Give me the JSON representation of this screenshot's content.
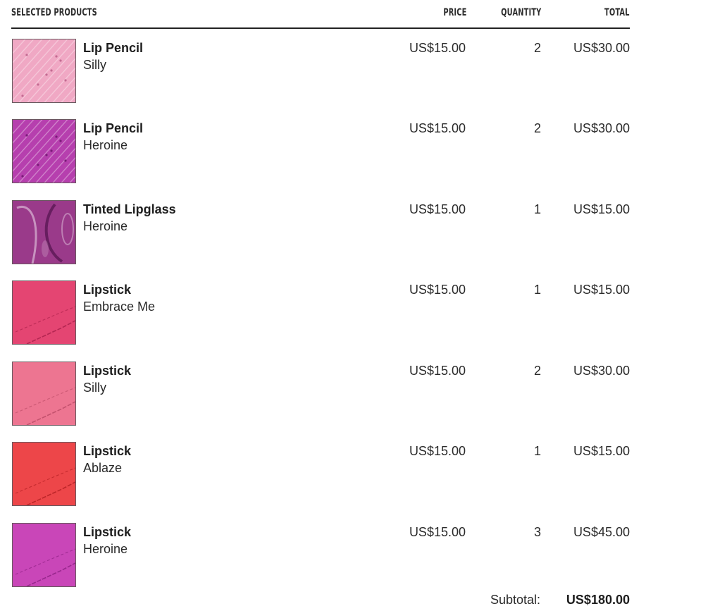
{
  "header": {
    "products": "SELECTED PRODUCTS",
    "price": "PRICE",
    "quantity": "QUANTITY",
    "total": "TOTAL"
  },
  "items": [
    {
      "name": "Lip Pencil",
      "shade": "Silly",
      "price": "US$15.00",
      "quantity": "2",
      "total": "US$30.00",
      "swatch_type": "pencil",
      "swatch_color": "#f0a8c4",
      "swatch_dark": "#c46b92"
    },
    {
      "name": "Lip Pencil",
      "shade": "Heroine",
      "price": "US$15.00",
      "quantity": "2",
      "total": "US$30.00",
      "swatch_type": "pencil",
      "swatch_color": "#b63fae",
      "swatch_dark": "#7a1c78"
    },
    {
      "name": "Tinted Lipglass",
      "shade": "Heroine",
      "price": "US$15.00",
      "quantity": "1",
      "total": "US$15.00",
      "swatch_type": "gloss",
      "swatch_color": "#9a3a8a",
      "swatch_dark": "#5a1854"
    },
    {
      "name": "Lipstick",
      "shade": "Embrace Me",
      "price": "US$15.00",
      "quantity": "1",
      "total": "US$15.00",
      "swatch_type": "lipstick",
      "swatch_color": "#e33a6a",
      "swatch_dark": "#a01a44"
    },
    {
      "name": "Lipstick",
      "shade": "Silly",
      "price": "US$15.00",
      "quantity": "2",
      "total": "US$30.00",
      "swatch_type": "lipstick",
      "swatch_color": "#ec6d8b",
      "swatch_dark": "#b2435f"
    },
    {
      "name": "Lipstick",
      "shade": "Ablaze",
      "price": "US$15.00",
      "quantity": "1",
      "total": "US$15.00",
      "swatch_type": "lipstick",
      "swatch_color": "#ec3b3e",
      "swatch_dark": "#a8181c"
    },
    {
      "name": "Lipstick",
      "shade": "Heroine",
      "price": "US$15.00",
      "quantity": "3",
      "total": "US$45.00",
      "swatch_type": "lipstick",
      "swatch_color": "#c63bb4",
      "swatch_dark": "#83197a"
    }
  ],
  "subtotal": {
    "label": "Subtotal:",
    "value": "US$180.00"
  }
}
